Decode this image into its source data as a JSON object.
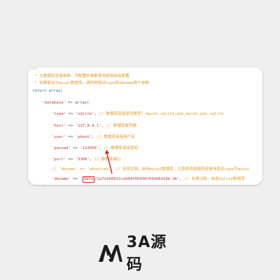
{
  "code": {
    "comment_head": "/*",
    "comment_1": " * 主数据库连接参数，不配置的参数使用框架缺省配置",
    "comment_2": " * 如果驱动为mysql数据库，请同时驱动type和dbname两个参数",
    "return_line": "return array(",
    "database_key": "'database'",
    "database_arrow": " => array(",
    "type_key": "'type'",
    "type_val": "'sqlite'",
    "type_comment": "// 数据库连接驱动类型: mysql,sqlite,pdo_mysql,pdo_sqlite",
    "host_key": "'host'",
    "host_val": "'127.0.0.1'",
    "host_comment": "// 数据库服务器",
    "user_key": "'user'",
    "user_val": "'pboot'",
    "user_comment": "// 数据库连接用户名",
    "passwd_key": "'passwd'",
    "passwd_val": "'123456'",
    "passwd_comment": "// 数据库连接密码",
    "port_key": "'port'",
    "port_val": "'3306'",
    "port_comment": "// 数据库端口",
    "dbname_comment_line": "// 'dbname' => 'pbootcms'  // 去掉注释，启用mysql数据库，注意修改前面的连接信息及type为mysql",
    "dbname_key": "'dbname'",
    "dbname_prefix": "'",
    "dbname_highlight": "data",
    "dbname_rest": "/2a7d160922cdd04f05436f03dd6d19b.db'",
    "dbname_comment": "// 去掉注释，启用Sqlite数据库",
    "close_brace": ")"
  },
  "logo": {
    "text": "3A源码",
    "mark_color": "#1d1d1d"
  },
  "colors": {
    "comment": "#e09a2a",
    "keyword": "#1a7b86",
    "string": "#c43838",
    "highlight_border": "#e21b1b"
  }
}
